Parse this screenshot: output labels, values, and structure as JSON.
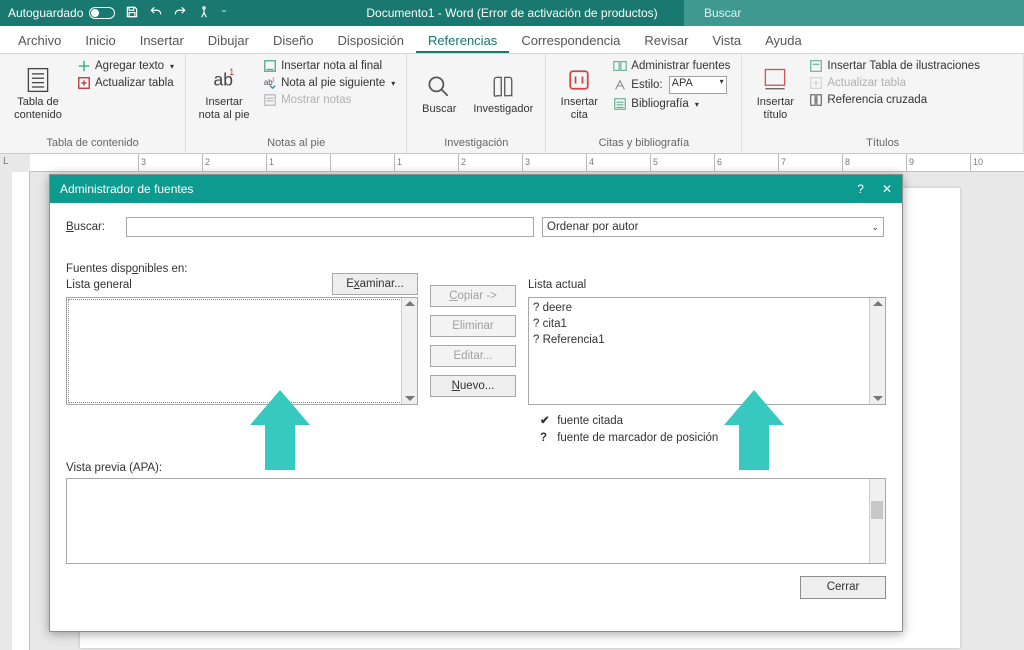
{
  "titlebar": {
    "autosave": "Autoguardado",
    "doc_title": "Documento1 - Word (Error de activación de productos)",
    "search_placeholder": "Buscar"
  },
  "tabs": {
    "file": "Archivo",
    "home": "Inicio",
    "insert": "Insertar",
    "draw": "Dibujar",
    "design": "Diseño",
    "layout": "Disposición",
    "references": "Referencias",
    "mailings": "Correspondencia",
    "review": "Revisar",
    "view": "Vista",
    "help": "Ayuda"
  },
  "ribbon": {
    "toc": {
      "big": "Tabla de\ncontenido",
      "add_text": "Agregar texto",
      "update": "Actualizar tabla",
      "group": "Tabla de contenido"
    },
    "footnotes": {
      "big": "Insertar\nnota al pie",
      "endnote": "Insertar nota al final",
      "next": "Nota al pie siguiente",
      "show": "Mostrar notas",
      "group": "Notas al pie"
    },
    "research": {
      "search": "Buscar",
      "researcher": "Investigador",
      "group": "Investigación"
    },
    "citations": {
      "big": "Insertar\ncita",
      "manage": "Administrar fuentes",
      "style_lbl": "Estilo:",
      "style_val": "APA",
      "biblio": "Bibliografía",
      "group": "Citas y bibliografía"
    },
    "captions": {
      "big": "Insertar\ntítulo",
      "fig_table": "Insertar Tabla de ilustraciones",
      "update": "Actualizar tabla",
      "crossref": "Referencia cruzada",
      "group": "Títulos"
    }
  },
  "ruler": {
    "left_letter": "L"
  },
  "dialog": {
    "title": "Administrador de fuentes",
    "search_lbl": "Buscar:",
    "search_lbl_hot": "B",
    "sort_value": "Ordenar por autor",
    "available_lbl": "Fuentes disponibles en:",
    "available_hot": "o",
    "master_list_lbl": "Lista general",
    "browse": "Examinar...",
    "browse_hot": "x",
    "copy": "Copiar ->",
    "copy_hot": "C",
    "delete": "Eliminar",
    "edit": "Editar...",
    "new": "Nuevo...",
    "new_hot": "N",
    "current_list_lbl": "Lista actual",
    "current_items": [
      "? deere",
      "? cita1",
      "? Referencia1"
    ],
    "legend_cited_mark": "✔",
    "legend_cited": "fuente citada",
    "legend_placeholder_mark": "?",
    "legend_placeholder": "fuente de marcador de posición",
    "preview_lbl": "Vista previa (APA):",
    "close": "Cerrar"
  },
  "colors": {
    "teal_dark": "#19786f",
    "teal_dialog": "#0d9b8f",
    "arrow": "#37c9c0"
  }
}
